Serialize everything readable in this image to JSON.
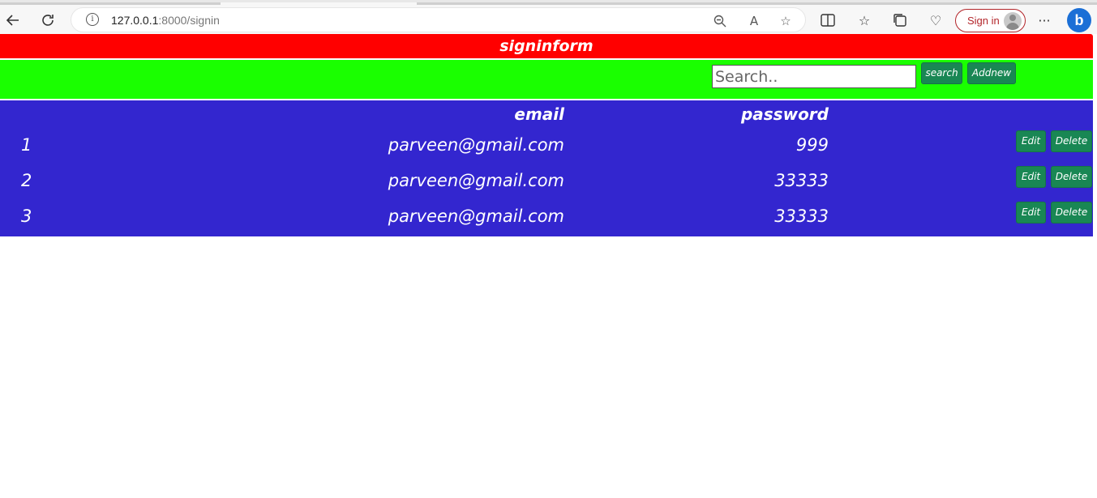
{
  "browser": {
    "url_host": "127.0.0.1",
    "url_path": ":8000/signin",
    "signin_label": "Sign in",
    "bing_label": "b"
  },
  "page": {
    "title": "signinform",
    "search": {
      "placeholder": "Search..",
      "button_label": "search"
    },
    "addnew_label": "Addnew",
    "table": {
      "headers": {
        "email": "email",
        "password": "password"
      },
      "rows": [
        {
          "id": "1",
          "email": "parveen@gmail.com",
          "password": "999",
          "edit_label": "Edit",
          "delete_label": "Delete"
        },
        {
          "id": "2",
          "email": "parveen@gmail.com",
          "password": "33333",
          "edit_label": "Edit",
          "delete_label": "Delete"
        },
        {
          "id": "3",
          "email": "parveen@gmail.com",
          "password": "33333",
          "edit_label": "Edit",
          "delete_label": "Delete"
        }
      ]
    }
  },
  "colors": {
    "title_bar": "#ff0000",
    "search_bar": "#1aff00",
    "table_bg": "#3326cf",
    "button_green": "#198754"
  }
}
